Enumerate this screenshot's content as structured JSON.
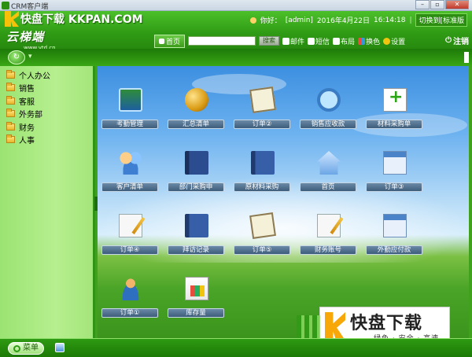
{
  "window": {
    "title": "CRM客户端",
    "controls": [
      "minimize",
      "restore",
      "close"
    ]
  },
  "watermark_top": "快盘下载 KKPAN.COM",
  "brand": {
    "name": "云梯端",
    "url": "www.ytd.cn"
  },
  "userbar": {
    "greeting": "你好：",
    "user": "[admin]",
    "date": "2016年4月22日",
    "time": "16:14:18",
    "switch_label": "切换到[标准版"
  },
  "nav": {
    "home_label": "首页",
    "search_placeholder": "",
    "search_button": "搜索",
    "tools": [
      {
        "label": "邮件",
        "icon": "mail-icon",
        "color": "#ffffff"
      },
      {
        "label": "短信",
        "icon": "sms-icon",
        "color": "#ffffff"
      },
      {
        "label": "布局",
        "icon": "layout-icon",
        "color": "#ffffff"
      },
      {
        "label": "换色",
        "icon": "color-icon",
        "color": "#e74c3c"
      },
      {
        "label": "设置",
        "icon": "gear-icon",
        "color": "#f1c40f"
      }
    ],
    "logout_label": "注销"
  },
  "sidebar": {
    "items": [
      {
        "label": "个人办公"
      },
      {
        "label": "销售"
      },
      {
        "label": "客服"
      },
      {
        "label": "外务部"
      },
      {
        "label": "财务"
      },
      {
        "label": "人事"
      }
    ]
  },
  "tiles": [
    {
      "label": "考勤管理",
      "icon": "attendance-icon"
    },
    {
      "label": "汇总清单",
      "icon": "coins-icon"
    },
    {
      "label": "订单②",
      "icon": "order-icon"
    },
    {
      "label": "销售应收款",
      "icon": "magnifier-icon"
    },
    {
      "label": "材料采购单",
      "icon": "add-document-icon"
    },
    {
      "label": "客户清单",
      "icon": "customers-icon"
    },
    {
      "label": "部门采购申",
      "icon": "address-book-icon"
    },
    {
      "label": "原材料采购",
      "icon": "book-icon"
    },
    {
      "label": "首页",
      "icon": "home-icon"
    },
    {
      "label": "订单③",
      "icon": "window-icon"
    },
    {
      "label": "订单④",
      "icon": "pencil-paper-icon"
    },
    {
      "label": "拜访记录",
      "icon": "book-icon"
    },
    {
      "label": "订单⑤",
      "icon": "order-icon"
    },
    {
      "label": "财务账号",
      "icon": "pencil-paper-icon"
    },
    {
      "label": "外勤应付款",
      "icon": "window-icon"
    },
    {
      "label": "订单①",
      "icon": "user-icon"
    },
    {
      "label": "库存量",
      "icon": "stock-icon"
    }
  ],
  "watermark_badge": {
    "big": "快盘下载",
    "small": "绿色 · 安全 · 高速"
  },
  "bottombar": {
    "menu_label": "菜单"
  }
}
